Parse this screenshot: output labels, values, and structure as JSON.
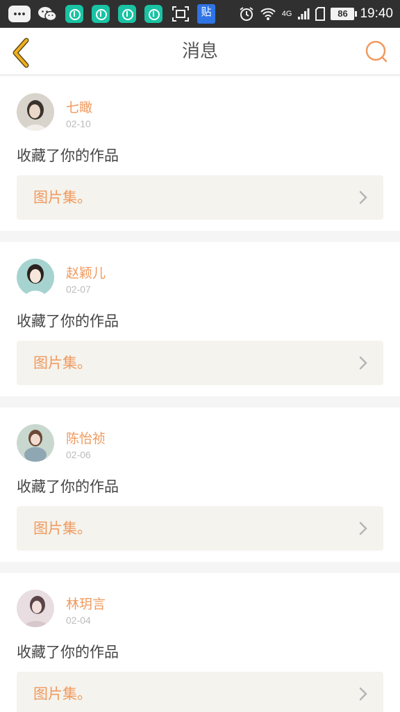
{
  "status_bar": {
    "time": "19:40",
    "battery": "86",
    "network": "4G",
    "colors": {
      "background": "#303030",
      "app_icon": "#19c3a3",
      "tieba_icon": "#2f74e5"
    },
    "tieba_label": "贴"
  },
  "header": {
    "title": "消息",
    "back_icon": "chevron-left-icon",
    "search_icon": "search-icon",
    "colors": {
      "back": "#f2b01e",
      "search": "#f09a5e"
    }
  },
  "theme": {
    "accent": "#f09a5e",
    "text": "#444444",
    "muted": "#bbbbbb",
    "card_bg": "#f4f3ee"
  },
  "messages": [
    {
      "user": "七瞰",
      "date": "02-10",
      "action": "收藏了你的作品",
      "item": "图片集。"
    },
    {
      "user": "赵颖儿",
      "date": "02-07",
      "action": "收藏了你的作品",
      "item": "图片集。"
    },
    {
      "user": "陈怡祯",
      "date": "02-06",
      "action": "收藏了你的作品",
      "item": "图片集。"
    },
    {
      "user": "林玥言",
      "date": "02-04",
      "action": "收藏了你的作品",
      "item": "图片集。"
    }
  ]
}
